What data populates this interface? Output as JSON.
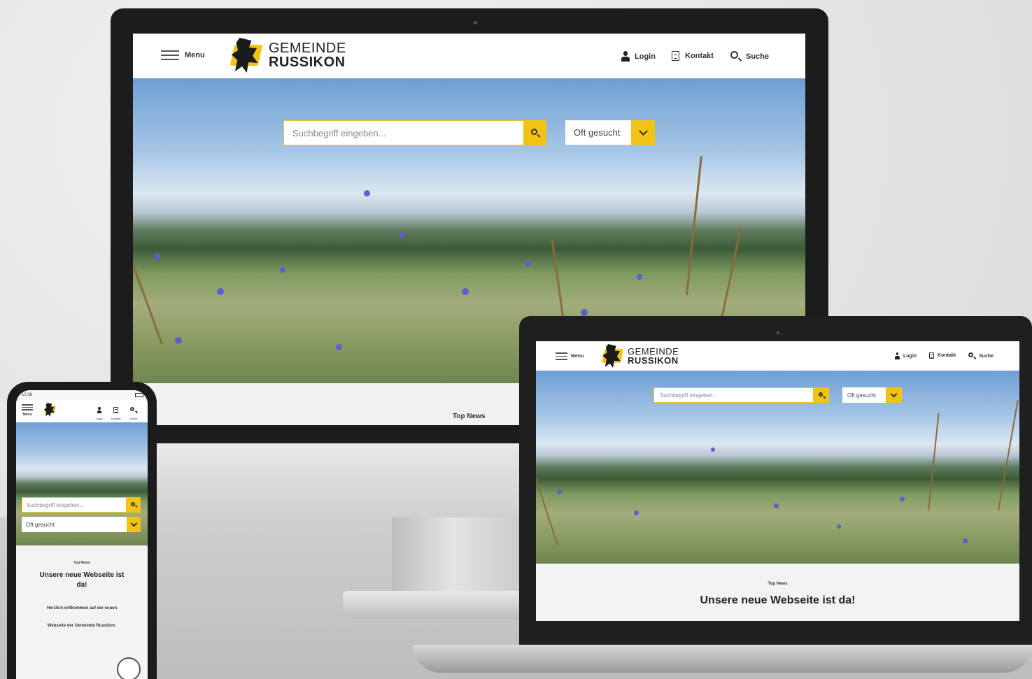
{
  "site": {
    "brand_line1": "GEMEINDE",
    "brand_line2": "RUSSIKON",
    "menu_label": "Menu",
    "nav": [
      {
        "label": "Login",
        "icon": "person-icon"
      },
      {
        "label": "Kontakt",
        "icon": "document-icon"
      },
      {
        "label": "Suche",
        "icon": "search-icon"
      }
    ],
    "search_placeholder": "Suchbegriff eingeben...",
    "frequent_label": "Oft gesucht",
    "top_news_label": "Top News",
    "headline": "Unsere neue Webseite ist da!",
    "intro_line1": "Herzlich willkommen auf der neuen",
    "intro_line2": "Webseite der Gemeinde Russikon."
  },
  "phone": {
    "status_time": "10:36",
    "headline_line1": "Unsere neue Webseite ist",
    "headline_line2": "da!"
  },
  "colors": {
    "accent": "#f2c315",
    "text_dark": "#222222",
    "frame": "#1c1c1c"
  }
}
